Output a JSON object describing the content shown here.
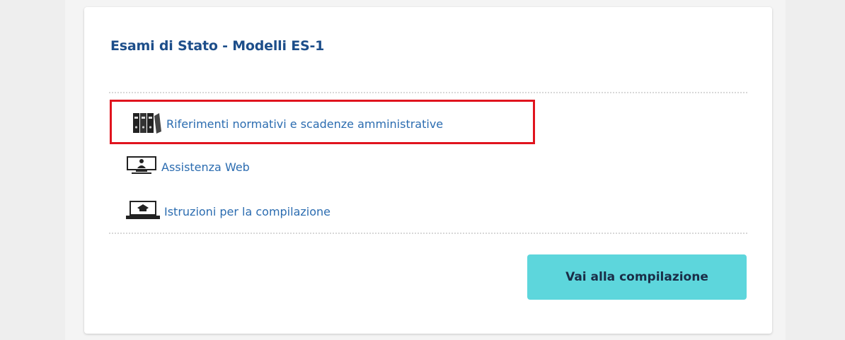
{
  "card": {
    "title": "Esami di Stato - Modelli ES-1"
  },
  "links": [
    {
      "label": "Riferimenti normativi e scadenze amministrative",
      "icon": "binders-icon"
    },
    {
      "label": "Assistenza Web",
      "icon": "monitor-support-icon"
    },
    {
      "label": "Istruzioni per la compilazione",
      "icon": "laptop-graduation-icon"
    }
  ],
  "action_button": {
    "label": "Vai alla compilazione"
  },
  "colors": {
    "title": "#1d4e8a",
    "link": "#2b6cb0",
    "button_bg": "#5dd6dc",
    "annotation": "#e0141e"
  }
}
